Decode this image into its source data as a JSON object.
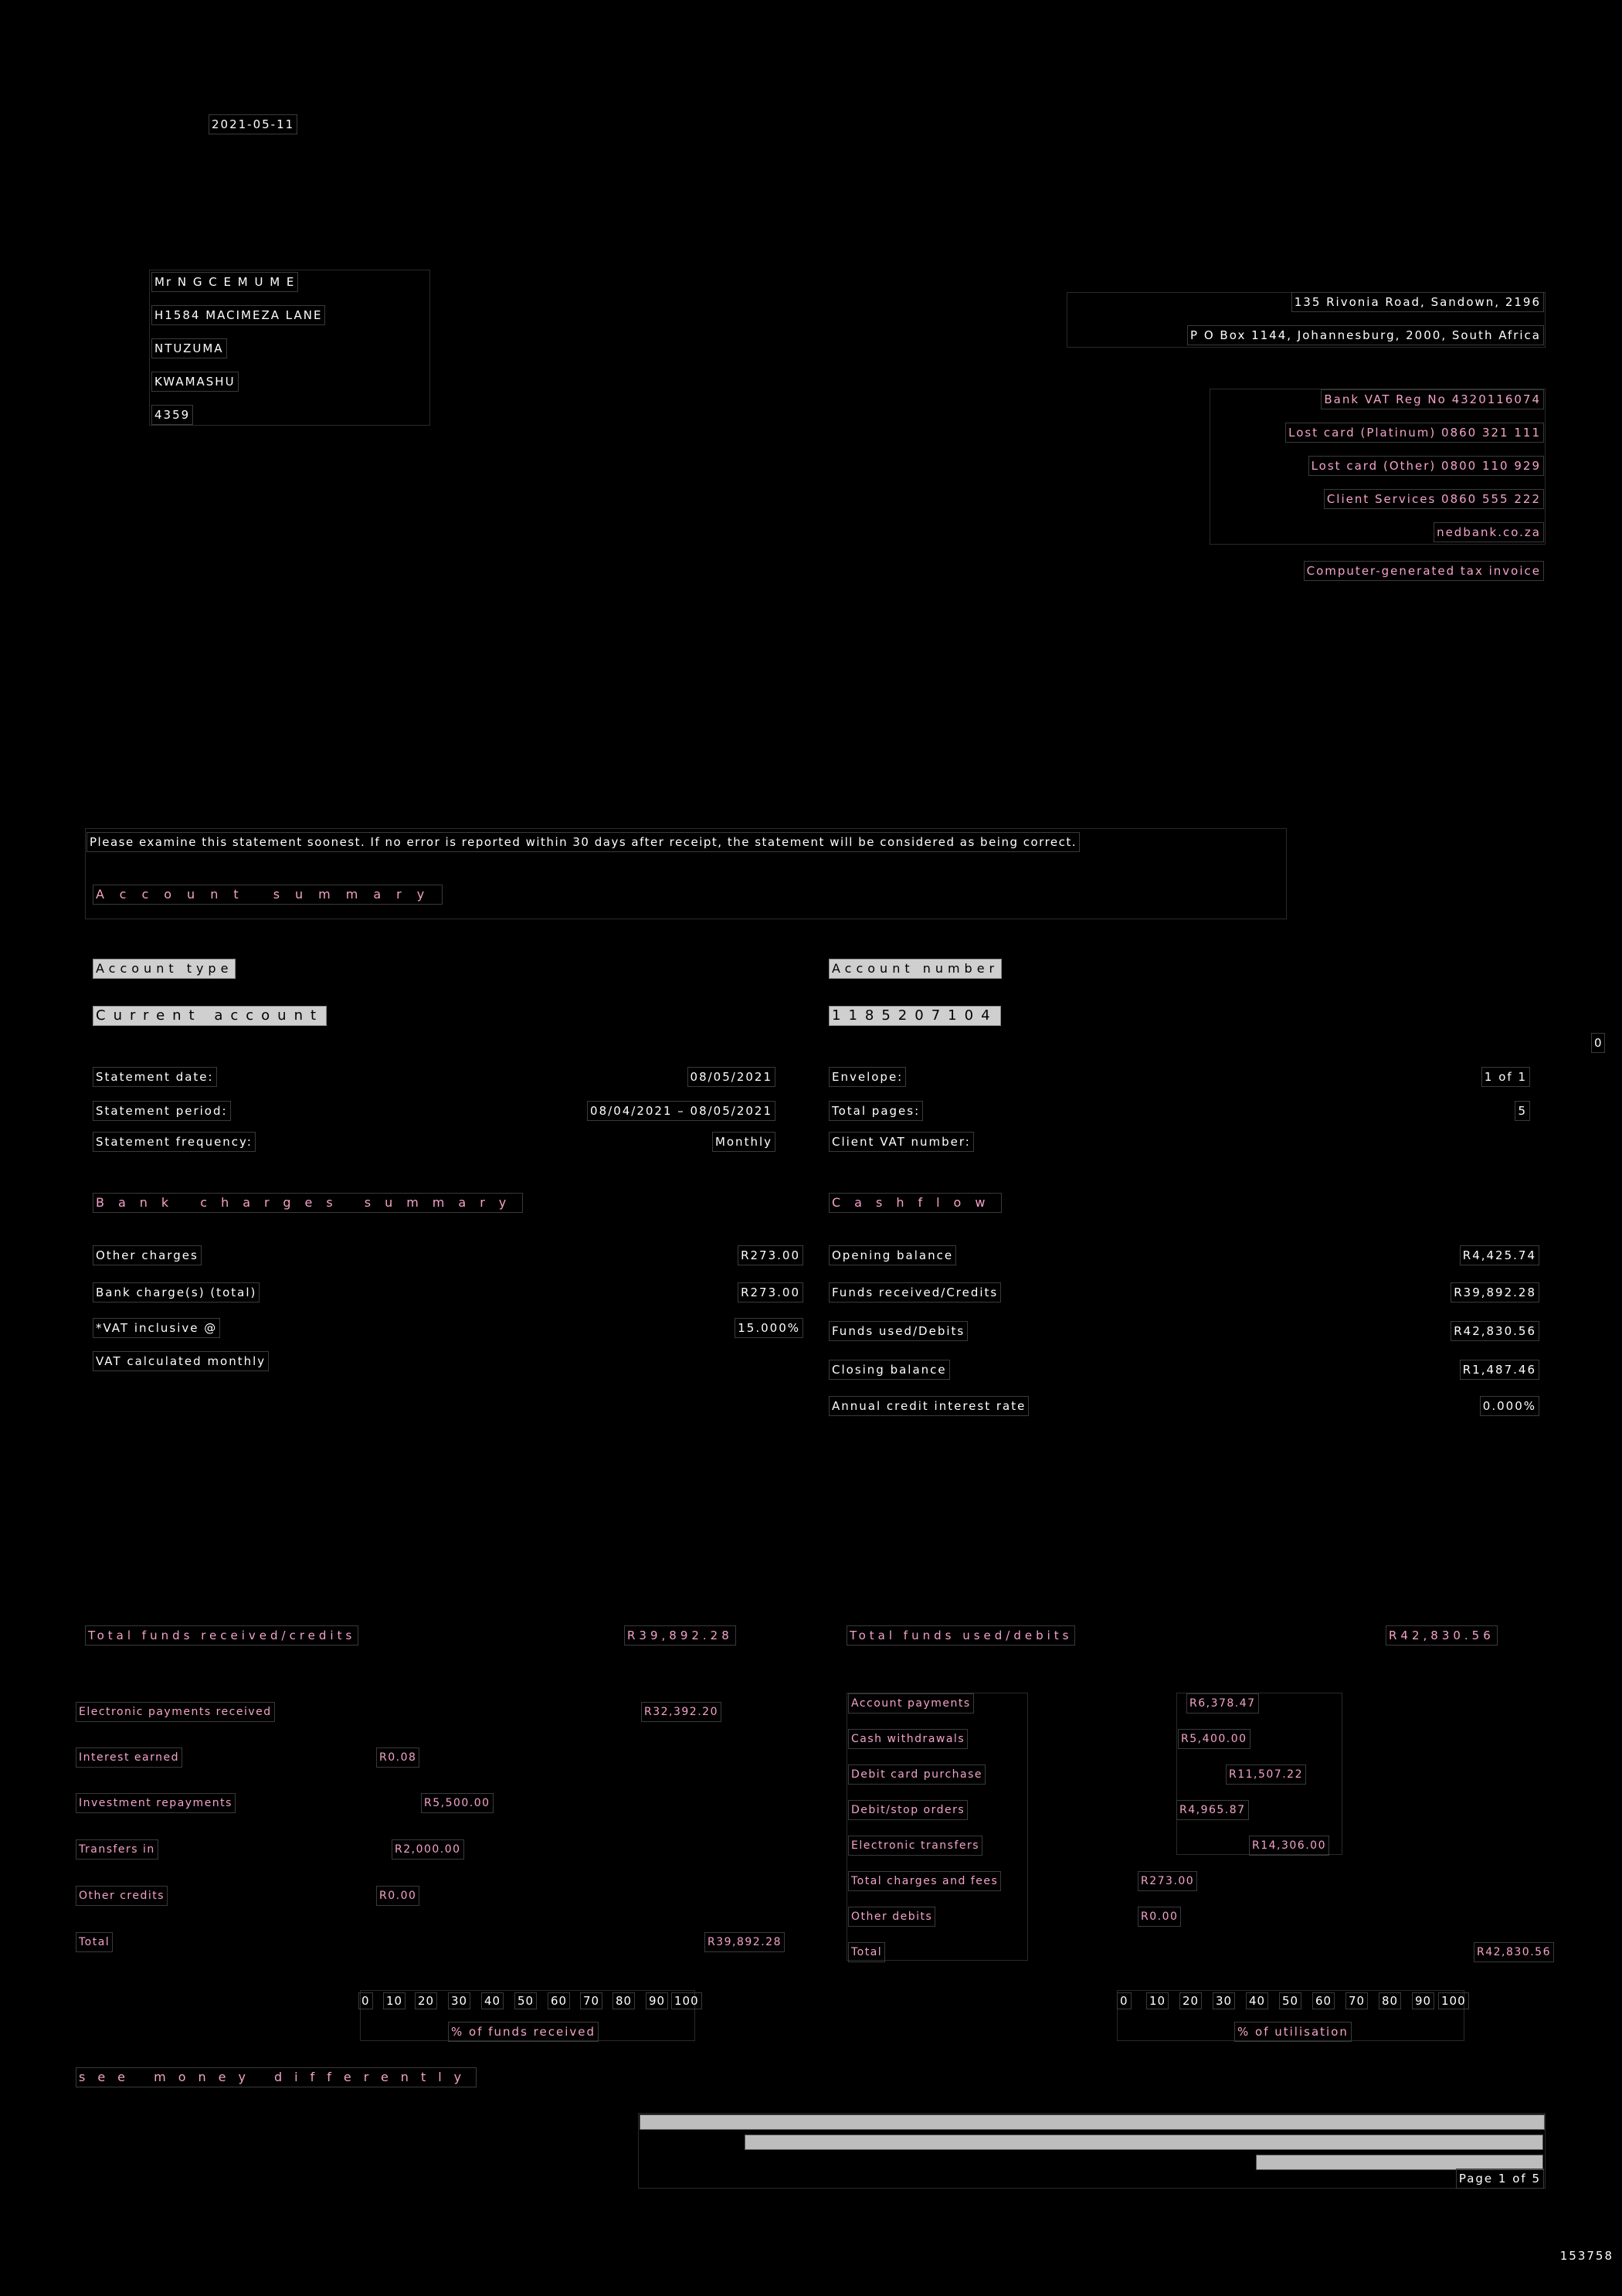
{
  "date": "2021-05-11",
  "recipient": {
    "lines": [
      "Mr N G C E M U M E",
      "H1584 MACIMEZA LANE",
      "NTUZUMA",
      "KWAMASHU",
      "4359"
    ]
  },
  "bank": {
    "address1": "135 Rivonia Road, Sandown, 2196",
    "address2": "P O Box 1144, Johannesburg, 2000, South Africa",
    "vat_reg": "Bank VAT Reg No 4320116074",
    "lost_platinum": "Lost card (Platinum) 0860 321 111",
    "lost_other": "Lost card (Other) 0800 110 929",
    "client_services": "Client Services 0860 555 222",
    "website": "nedbank.co.za",
    "tax_invoice": "Computer-generated tax invoice"
  },
  "notice": "Please examine this statement soonest. If no error is reported within 30 days after receipt, the statement will be considered as being correct.",
  "account_summary_title": "Account summary",
  "account_type_label": "Account type",
  "account_type_value": "Current account",
  "account_number_label": "Account number",
  "account_number_value": "1185207104",
  "side_marker": "0",
  "statement": {
    "date_label": "Statement date:",
    "date_value": "08/05/2021",
    "period_label": "Statement period:",
    "period_value": "08/04/2021 – 08/05/2021",
    "frequency_label": "Statement frequency:",
    "frequency_value": "Monthly"
  },
  "envelope": {
    "envelope_label": "Envelope:",
    "envelope_value": "1 of 1",
    "pages_label": "Total pages:",
    "pages_value": "5",
    "client_vat_label": "Client VAT number:"
  },
  "bank_charges": {
    "title": "Bank charges summary",
    "rows": [
      {
        "label": "Other charges",
        "value": "R273.00"
      },
      {
        "label": "Bank charge(s) (total)",
        "value": "R273.00"
      },
      {
        "label": "*VAT inclusive @",
        "value": "15.000%"
      },
      {
        "label": "VAT calculated monthly",
        "value": ""
      }
    ]
  },
  "cashflow": {
    "title": "Cashflow",
    "rows": [
      {
        "label": "Opening balance",
        "value": "R4,425.74"
      },
      {
        "label": "Funds received/Credits",
        "value": "R39,892.28"
      },
      {
        "label": "Funds used/Debits",
        "value": "R42,830.56"
      },
      {
        "label": "Closing balance",
        "value": "R1,487.46"
      },
      {
        "label": "Annual credit interest rate",
        "value": "0.000%"
      }
    ]
  },
  "received": {
    "title": "Total funds received/credits",
    "total_value": "R39,892.28",
    "rows": [
      {
        "label": "Electronic payments received",
        "value": "R32,392.20"
      },
      {
        "label": "Interest earned",
        "value": "R0.08"
      },
      {
        "label": "Investment repayments",
        "value": "R5,500.00"
      },
      {
        "label": "Transfers in",
        "value": "R2,000.00"
      },
      {
        "label": "Other credits",
        "value": "R0.00"
      },
      {
        "label": "Total",
        "value": "R39,892.28"
      }
    ],
    "axis_ticks": [
      "0",
      "10",
      "20",
      "30",
      "40",
      "50",
      "60",
      "70",
      "80",
      "90",
      "100"
    ],
    "axis_label": "% of funds received"
  },
  "used": {
    "title": "Total funds used/debits",
    "total_value": "R42,830.56",
    "rows": [
      {
        "label": "Account payments",
        "value": "R6,378.47"
      },
      {
        "label": "Cash withdrawals",
        "value": "R5,400.00"
      },
      {
        "label": "Debit card purchase",
        "value": "R11,507.22"
      },
      {
        "label": "Debit/stop orders",
        "value": "R4,965.87"
      },
      {
        "label": "Electronic transfers",
        "value": "R14,306.00"
      },
      {
        "label": "Total charges and fees",
        "value": "R273.00"
      },
      {
        "label": "Other debits",
        "value": "R0.00"
      },
      {
        "label": "Total",
        "value": "R42,830.56"
      }
    ],
    "axis_ticks": [
      "0",
      "10",
      "20",
      "30",
      "40",
      "50",
      "60",
      "70",
      "80",
      "90",
      "100"
    ],
    "axis_label": "% of utilisation"
  },
  "slogan": "see money differently",
  "page": "Page 1 of 5",
  "doc_number": "153758"
}
